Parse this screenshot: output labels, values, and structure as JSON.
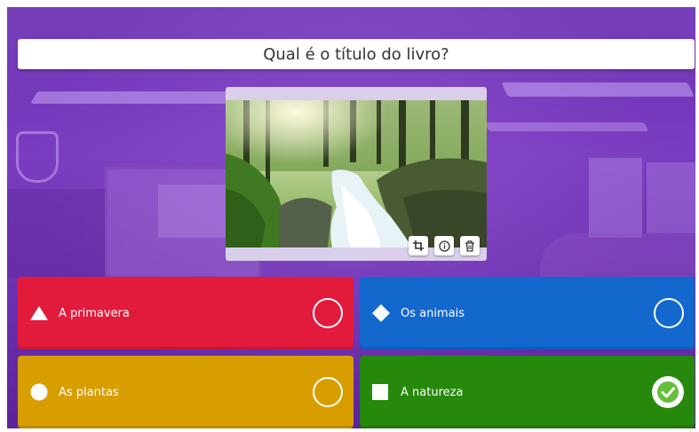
{
  "question": {
    "text": "Qual é o título do livro?"
  },
  "image_tools": [
    {
      "name": "crop-icon"
    },
    {
      "name": "info-icon"
    },
    {
      "name": "trash-icon"
    }
  ],
  "answers": [
    {
      "label": "A primavera",
      "shape": "triangle",
      "color": "#e21b3c",
      "correct": false
    },
    {
      "label": "Os animais",
      "shape": "diamond",
      "color": "#1368ce",
      "correct": false
    },
    {
      "label": "As plantas",
      "shape": "circle",
      "color": "#d89e00",
      "correct": false
    },
    {
      "label": "A natureza",
      "shape": "square",
      "color": "#26890c",
      "correct": true
    }
  ]
}
